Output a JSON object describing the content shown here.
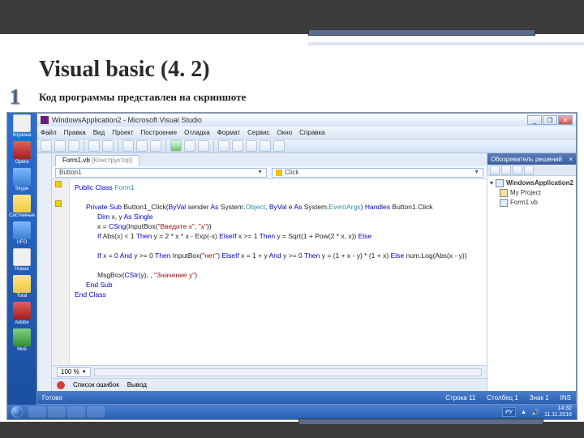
{
  "slide": {
    "title": "Visual basic (4. 2)",
    "number": "1",
    "subtitle": "Код программы представлен на скриншоте"
  },
  "desktop": {
    "icons": [
      "Корзина",
      "Opera",
      "Skype",
      "Системные",
      "UFO",
      "Новая",
      "Total",
      "Adobe",
      "Мой"
    ]
  },
  "vs": {
    "title": "WindowsApplication2 - Microsoft Visual Studio",
    "menu": [
      "Файл",
      "Правка",
      "Вид",
      "Проект",
      "Построение",
      "Отладка",
      "Формат",
      "Сервис",
      "Окно",
      "Справка"
    ],
    "tab": "Form1.vb",
    "tab_suffix": "[Конструктор]",
    "combo_left": "Button1",
    "combo_right": "Click",
    "sol_explorer_title": "Обозреватель решений",
    "sol_root": "WindowsApplication2",
    "sol_items": [
      "My Project",
      "Form1.vb"
    ],
    "zoom": "100 %",
    "status_ready": "Готово",
    "status_ln": "Строка 11",
    "status_col": "Столбец 1",
    "status_ch": "Знак 1",
    "status_ins": "INS",
    "output_tab": "Список ошибок",
    "output_tab2": "Вывод",
    "code": {
      "l0a": "Public",
      "l0b": "Class",
      "l0c": "Form1",
      "l1a": "Private",
      "l1b": "Sub",
      "l1c": "Button1_Click(",
      "l1d": "ByVal",
      "l1e": "sender",
      "l1f": "As",
      "l1g": "System.",
      "l1h": "Object",
      "l1i": ",",
      "l1j": "ByVal",
      "l1k": "e",
      "l1l": "As",
      "l1m": "System.",
      "l1n": "EventArgs",
      "l1o": ")",
      "l1p": "Handles",
      "l1q": "Button1.Click",
      "l2a": "Dim",
      "l2b": "x, y",
      "l2c": "As",
      "l2d": "Single",
      "l3a": "x =",
      "l3b": "CSng",
      "l3c": "(InputBox(",
      "l3d": "\"Введите x\"",
      "l3e": ",",
      "l3f": "\"x\"",
      "l3g": "))",
      "l4a": "If",
      "l4b": "Abs(x) < 1",
      "l4c": "Then",
      "l4d": "y = 2 * x * x -",
      "l4e": "Exp",
      "l4f": "(-x)",
      "l4g": "ElseIf",
      "l4h": "x >= 1",
      "l4i": "Then",
      "l4j": "y = Sqrt(1 +",
      "l4k": "Pow",
      "l4l": "(2 * x, x))",
      "l4m": "Else",
      "l5a": "If",
      "l5b": "x = 0",
      "l5c": "And",
      "l5d": "y >= 0",
      "l5e": "Then",
      "l5f": "InputBox(",
      "l5g": "\"нет\"",
      "l5h": ")",
      "l5i": "ElseIf",
      "l5j": "x = 1 + y",
      "l5k": "And",
      "l5l": "y >= 0",
      "l5m": "Then",
      "l5n": "y = (1 + x - y) * (1 + x)",
      "l5o": "Else",
      "l5p": "num.Log(Abs(x - y))",
      "l6a": "MsgBox(",
      "l6b": "CStr",
      "l6c": "(y), ,",
      "l6d": "\"Значение y\"",
      "l6e": ")",
      "l7a": "End",
      "l7b": "Sub",
      "l8a": "End",
      "l8b": "Class"
    }
  },
  "taskbar": {
    "lang": "РУ",
    "time": "14:32",
    "date": "11.11.2016"
  }
}
